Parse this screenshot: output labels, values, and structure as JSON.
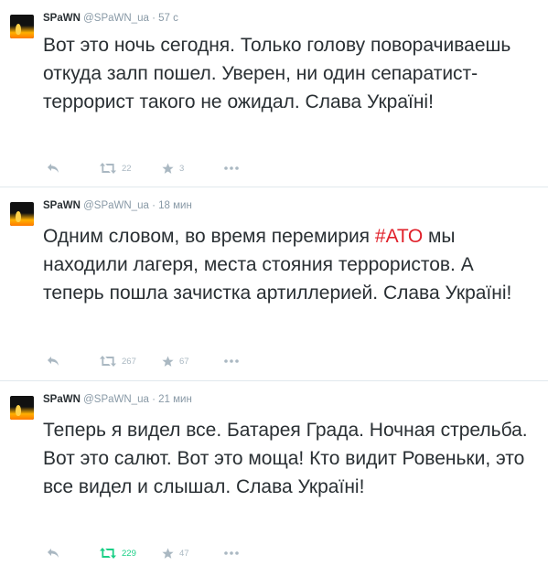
{
  "tweets": [
    {
      "name": "SPaWN",
      "handle": "@SPaWN_ua",
      "separator": "·",
      "time": "57 с",
      "text_before": "Вот это ночь сегодня. Только голову поворачиваешь откуда залп пошел. Уверен, ни один сепаратист-террорист такого не ожидал. Слава Україні!",
      "hashtag": "",
      "text_after": "",
      "retweets": "22",
      "favorites": "3",
      "retweeted": false
    },
    {
      "name": "SPaWN",
      "handle": "@SPaWN_ua",
      "separator": "·",
      "time": "18 мин",
      "text_before": "Одним словом, во время перемирия ",
      "hashtag": "#АТО",
      "text_after": " мы находили лагеря, места стояния террористов. А теперь пошла зачистка артиллерией. Слава Україні!",
      "retweets": "267",
      "favorites": "67",
      "retweeted": false
    },
    {
      "name": "SPaWN",
      "handle": "@SPaWN_ua",
      "separator": "·",
      "time": "21 мин",
      "text_before": "Теперь я видел все. Батарея Града. Ночная стрельба. Вот это салют. Вот это моща! Кто видит Ровеньки, это все видел и слышал. Слава Україні!",
      "hashtag": "",
      "text_after": "",
      "retweets": "229",
      "favorites": "47",
      "retweeted": true
    }
  ],
  "icons": {
    "reply": "reply-icon",
    "retweet": "retweet-icon",
    "favorite": "star-icon",
    "more": "more-icon"
  },
  "colors": {
    "text": "#292f33",
    "meta": "#8899a6",
    "action": "#aab8c2",
    "hashtag": "#e0202a",
    "retweet_active": "#19cf86"
  }
}
